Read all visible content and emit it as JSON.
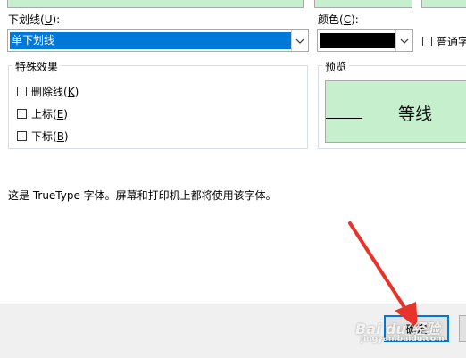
{
  "dialog": {
    "underline_label": "下划线(",
    "underline_hotkey": "U",
    "underline_label_end": "):",
    "underline_value": "单下划线",
    "color_label": "颜色(",
    "color_hotkey": "C",
    "color_label_end": "):",
    "color_value_hex": "#000000",
    "normal_font_label": "普通字",
    "effects_title": "特殊效果",
    "effects": [
      {
        "label": "删除线(",
        "hotkey": "K",
        "end": ")"
      },
      {
        "label": "上标(",
        "hotkey": "E",
        "end": ")"
      },
      {
        "label": "下标(",
        "hotkey": "B",
        "end": ")"
      }
    ],
    "preview_title": "预览",
    "preview_text": "等线",
    "preview_bg": "#c6efce",
    "info_text": "这是 TrueType 字体。屏幕和打印机上都将使用该字体。",
    "ok_button": "确定"
  },
  "overlay": {
    "watermark": "Bai du 经验",
    "watermark_url": "jingyan.baidu.com",
    "arrow_color": "#e8332a"
  }
}
